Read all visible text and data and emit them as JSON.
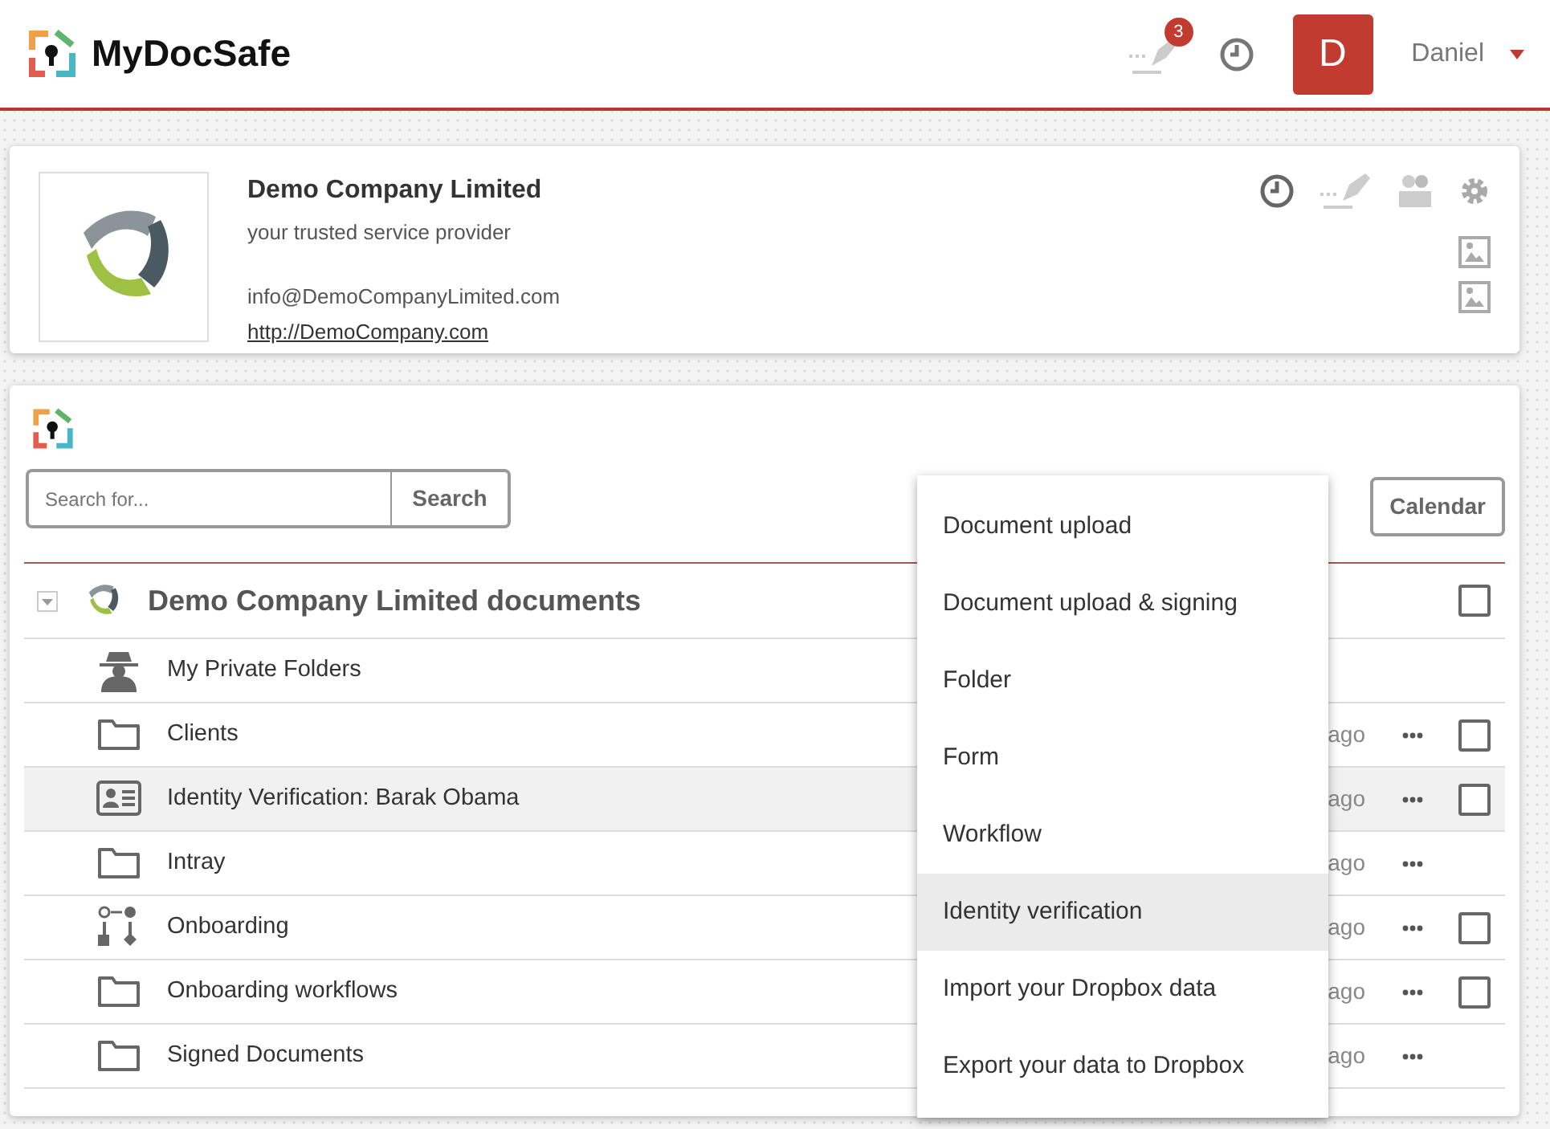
{
  "header": {
    "logo_text": "MyDocSafe",
    "notification_count": "3",
    "avatar_letter": "D",
    "user_name": "Daniel"
  },
  "company": {
    "name": "Demo Company Limited",
    "tagline": "your trusted service provider",
    "email": "info@DemoCompanyLimited.com",
    "website": "http://DemoCompany.com"
  },
  "search": {
    "placeholder": "Search for...",
    "button": "Search"
  },
  "calendar_button": "Calendar",
  "tree": {
    "title": "Demo Company Limited documents",
    "checkbox": true,
    "checked": false,
    "rows": [
      {
        "kind": "private",
        "name": "My Private Folders",
        "highlighted": false,
        "actions": false,
        "checkbox": false
      },
      {
        "kind": "folder",
        "name": "Clients",
        "time": "ago",
        "highlighted": false,
        "actions": true,
        "checkbox": true,
        "checked": false
      },
      {
        "kind": "identity",
        "name": "Identity Verification: Barak Obama",
        "time": "ago",
        "highlighted": true,
        "actions": true,
        "checkbox": true,
        "checked": false
      },
      {
        "kind": "folder",
        "name": "Intray",
        "time": "ago",
        "highlighted": false,
        "actions": true,
        "checkbox": false
      },
      {
        "kind": "workflow",
        "name": "Onboarding",
        "time": "ago",
        "highlighted": false,
        "actions": true,
        "checkbox": true,
        "checked": false
      },
      {
        "kind": "folder",
        "name": "Onboarding workflows",
        "time": "ago",
        "highlighted": false,
        "actions": true,
        "checkbox": true,
        "checked": false
      },
      {
        "kind": "folder",
        "name": "Signed Documents",
        "time": "ago",
        "highlighted": false,
        "actions": true,
        "checkbox": false
      }
    ]
  },
  "new_menu": [
    {
      "label": "Document upload",
      "selected": false
    },
    {
      "label": "Document upload & signing",
      "selected": false
    },
    {
      "label": "Folder",
      "selected": false
    },
    {
      "label": "Form",
      "selected": false
    },
    {
      "label": "Workflow",
      "selected": false
    },
    {
      "label": "Identity verification",
      "selected": true
    },
    {
      "label": "Import your Dropbox data",
      "selected": false
    },
    {
      "label": "Export your data to Dropbox",
      "selected": false
    }
  ]
}
